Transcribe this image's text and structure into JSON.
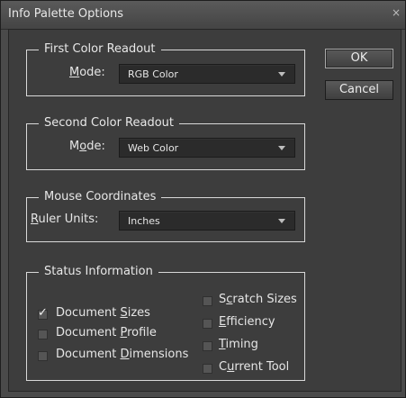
{
  "window": {
    "title": "Info Palette Options",
    "close_glyph": "×"
  },
  "buttons": {
    "ok": "OK",
    "cancel": "Cancel"
  },
  "first": {
    "legend": "First Color Readout",
    "mode_pre": "",
    "mode_u": "M",
    "mode_post": "ode:",
    "value": "RGB Color"
  },
  "second": {
    "legend": "Second Color Readout",
    "mode_pre": "M",
    "mode_u": "o",
    "mode_post": "de:",
    "value": "Web Color"
  },
  "mouse": {
    "legend": "Mouse Coordinates",
    "units_pre": "",
    "units_u": "R",
    "units_post": "uler Units:",
    "value": "Inches"
  },
  "status": {
    "legend": "Status Information",
    "checkmark": "✓",
    "items": [
      {
        "pre": "Document ",
        "u": "S",
        "post": "izes",
        "checked": true
      },
      {
        "pre": "Document ",
        "u": "P",
        "post": "rofile",
        "checked": false
      },
      {
        "pre": "Document ",
        "u": "D",
        "post": "imensions",
        "checked": false
      },
      {
        "pre": "S",
        "u": "c",
        "post": "ratch Sizes",
        "checked": false
      },
      {
        "pre": "",
        "u": "E",
        "post": "fficiency",
        "checked": false
      },
      {
        "pre": "",
        "u": "T",
        "post": "iming",
        "checked": false
      },
      {
        "pre": "C",
        "u": "u",
        "post": "rrent Tool",
        "checked": false
      }
    ]
  }
}
